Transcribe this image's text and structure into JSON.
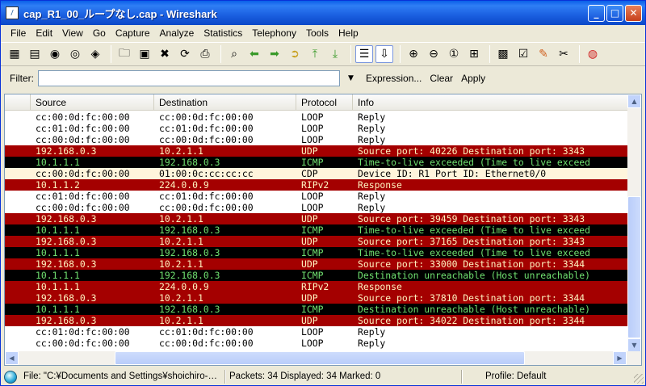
{
  "window": {
    "title": "cap_R1_00_ループなし.cap - Wireshark",
    "icon": "shark-fin-icon"
  },
  "menu": [
    "File",
    "Edit",
    "View",
    "Go",
    "Capture",
    "Analyze",
    "Statistics",
    "Telephony",
    "Tools",
    "Help"
  ],
  "filter": {
    "label": "Filter:",
    "value": "",
    "expression_label": "Expression...",
    "clear_label": "Clear",
    "apply_label": "Apply"
  },
  "columns": {
    "no": "",
    "source": "Source",
    "destination": "Destination",
    "protocol": "Protocol",
    "info": "Info"
  },
  "packets": [
    {
      "src": "cc:00:0d:fc:00:00",
      "dst": "cc:00:0d:fc:00:00",
      "proto": "LOOP",
      "info": "Reply",
      "style": "loop"
    },
    {
      "src": "cc:01:0d:fc:00:00",
      "dst": "cc:01:0d:fc:00:00",
      "proto": "LOOP",
      "info": "Reply",
      "style": "loop"
    },
    {
      "src": "cc:00:0d:fc:00:00",
      "dst": "cc:00:0d:fc:00:00",
      "proto": "LOOP",
      "info": "Reply",
      "style": "loop"
    },
    {
      "src": "192.168.0.3",
      "dst": "10.2.1.1",
      "proto": "UDP",
      "info": "Source port: 40226  Destination port: 3343",
      "style": "red"
    },
    {
      "src": "10.1.1.1",
      "dst": "192.168.0.3",
      "proto": "ICMP",
      "info": "Time-to-live exceeded (Time to live exceed",
      "style": "black"
    },
    {
      "src": "cc:00:0d:fc:00:00",
      "dst": "01:00:0c:cc:cc:cc",
      "proto": "CDP",
      "info": "Device ID: R1  Port ID: Ethernet0/0",
      "style": "cdp"
    },
    {
      "src": "10.1.1.2",
      "dst": "224.0.0.9",
      "proto": "RIPv2",
      "info": "Response",
      "style": "red"
    },
    {
      "src": "cc:01:0d:fc:00:00",
      "dst": "cc:01:0d:fc:00:00",
      "proto": "LOOP",
      "info": "Reply",
      "style": "loop"
    },
    {
      "src": "cc:00:0d:fc:00:00",
      "dst": "cc:00:0d:fc:00:00",
      "proto": "LOOP",
      "info": "Reply",
      "style": "loop"
    },
    {
      "src": "192.168.0.3",
      "dst": "10.2.1.1",
      "proto": "UDP",
      "info": "Source port: 39459  Destination port: 3343",
      "style": "red"
    },
    {
      "src": "10.1.1.1",
      "dst": "192.168.0.3",
      "proto": "ICMP",
      "info": "Time-to-live exceeded (Time to live exceed",
      "style": "black"
    },
    {
      "src": "192.168.0.3",
      "dst": "10.2.1.1",
      "proto": "UDP",
      "info": "Source port: 37165  Destination port: 3343",
      "style": "red"
    },
    {
      "src": "10.1.1.1",
      "dst": "192.168.0.3",
      "proto": "ICMP",
      "info": "Time-to-live exceeded (Time to live exceed",
      "style": "black"
    },
    {
      "src": "192.168.0.3",
      "dst": "10.2.1.1",
      "proto": "UDP",
      "info": "Source port: 33000  Destination port: 3344",
      "style": "red"
    },
    {
      "src": "10.1.1.1",
      "dst": "192.168.0.3",
      "proto": "ICMP",
      "info": "Destination unreachable (Host unreachable)",
      "style": "black"
    },
    {
      "src": "10.1.1.1",
      "dst": "224.0.0.9",
      "proto": "RIPv2",
      "info": "Response",
      "style": "red"
    },
    {
      "src": "192.168.0.3",
      "dst": "10.2.1.1",
      "proto": "UDP",
      "info": "Source port: 37810  Destination port: 3344",
      "style": "red"
    },
    {
      "src": "10.1.1.1",
      "dst": "192.168.0.3",
      "proto": "ICMP",
      "info": "Destination unreachable (Host unreachable)",
      "style": "black"
    },
    {
      "src": "192.168.0.3",
      "dst": "10.2.1.1",
      "proto": "UDP",
      "info": "Source port: 34022  Destination port: 3344",
      "style": "red"
    },
    {
      "src": "cc:01:0d:fc:00:00",
      "dst": "cc:01:0d:fc:00:00",
      "proto": "LOOP",
      "info": "Reply",
      "style": "loop"
    },
    {
      "src": "cc:00:0d:fc:00:00",
      "dst": "cc:00:0d:fc:00:00",
      "proto": "LOOP",
      "info": "Reply",
      "style": "loop"
    }
  ],
  "row_colors": {
    "loop_bg": "#ffffff",
    "loop_fg": "#000000",
    "red_bg": "#a40000",
    "red_fg": "#fff4c0",
    "black_bg": "#000000",
    "black_fg": "#70e070",
    "cdp_bg": "#fff5dc",
    "cdp_fg": "#000000"
  },
  "status": {
    "file": "File: \"C:¥Documents and Settings¥shoichiro-…",
    "packets": "Packets: 34 Displayed: 34 Marked: 0",
    "profile": "Profile: Default"
  }
}
